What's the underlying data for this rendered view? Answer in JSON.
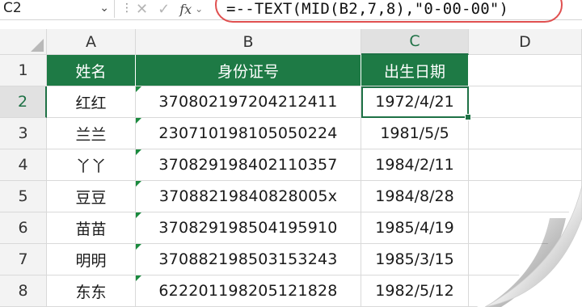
{
  "formula_bar": {
    "name_box": "C2",
    "fx_label": "fx",
    "formula": "=--TEXT(MID(B2,7,8),\"0-00-00\")"
  },
  "columns": [
    "A",
    "B",
    "C",
    "D"
  ],
  "header": {
    "row_number": "1",
    "name": "姓名",
    "id": "身份证号",
    "birth": "出生日期"
  },
  "rows": [
    {
      "num": "2",
      "name": "红红",
      "id": "370802197204212411",
      "birth": "1972/4/21"
    },
    {
      "num": "3",
      "name": "兰兰",
      "id": "230710198105050224",
      "birth": "1981/5/5"
    },
    {
      "num": "4",
      "name": "丫丫",
      "id": "370829198402110357",
      "birth": "1984/2/11"
    },
    {
      "num": "5",
      "name": "豆豆",
      "id": "37088219840828005x",
      "birth": "1984/8/28"
    },
    {
      "num": "6",
      "name": "苗苗",
      "id": "370829198504195910",
      "birth": "1985/4/19"
    },
    {
      "num": "7",
      "name": "明明",
      "id": "370882198503153243",
      "birth": "1985/3/15"
    },
    {
      "num": "8",
      "name": "东东",
      "id": "622201198205121828",
      "birth": "1982/5/12"
    }
  ],
  "colors": {
    "header_green": "#1e7a45",
    "selection_green": "#1e7145",
    "formula_highlight": "#e05050"
  }
}
